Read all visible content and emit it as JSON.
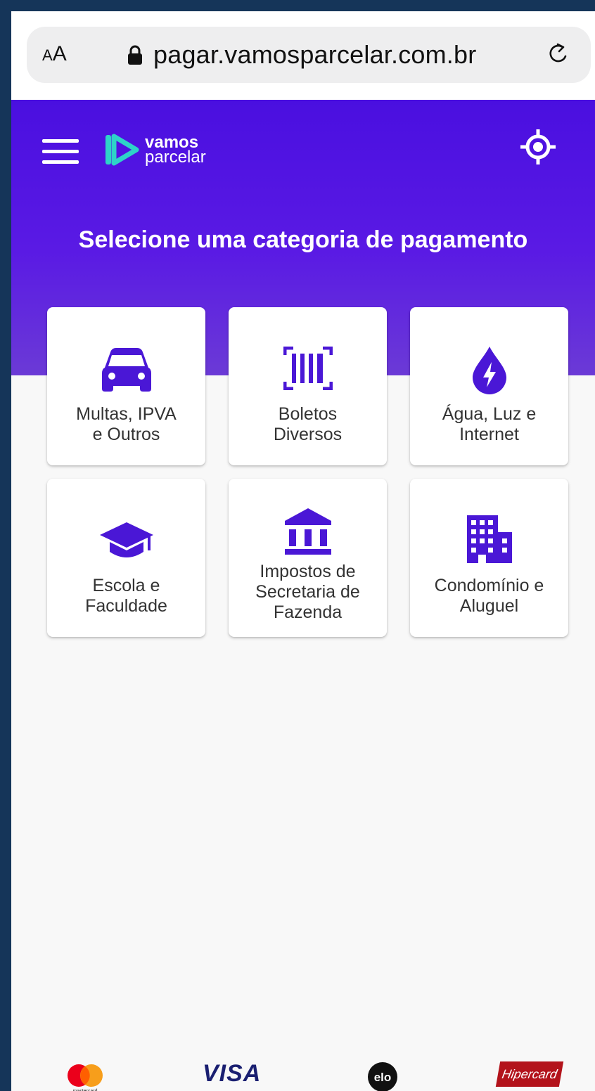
{
  "browser": {
    "text_size_label_small": "A",
    "text_size_label_large": "A",
    "url": "pagar.vamosparcelar.com.br"
  },
  "header": {
    "logo_line1": "vamos",
    "logo_line2": "parcelar",
    "title": "Selecione uma categoria de pagamento"
  },
  "categories": [
    {
      "line1": "Multas, IPVA",
      "line2": "e Outros",
      "icon": "car-icon"
    },
    {
      "line1": "Boletos",
      "line2": "Diversos",
      "icon": "barcode-icon"
    },
    {
      "line1": "Água, Luz e",
      "line2": "Internet",
      "icon": "water-drop-bolt-icon"
    },
    {
      "line1": "Escola e",
      "line2": "Faculdade",
      "icon": "graduation-cap-icon"
    },
    {
      "line1": "Impostos de",
      "line2": "Secretaria de",
      "line3": "Fazenda",
      "icon": "bank-building-icon"
    },
    {
      "line1": "Condomínio e",
      "line2": "Aluguel",
      "icon": "apartment-building-icon"
    }
  ],
  "payment_brands": {
    "mastercard": "mastercard",
    "visa": "VISA",
    "elo": "elo",
    "hipercard": "Hipercard"
  },
  "colors": {
    "brand_purple": "#4a0fe0",
    "icon_purple": "#4a17d6",
    "logo_teal": "#2ed3c8"
  }
}
